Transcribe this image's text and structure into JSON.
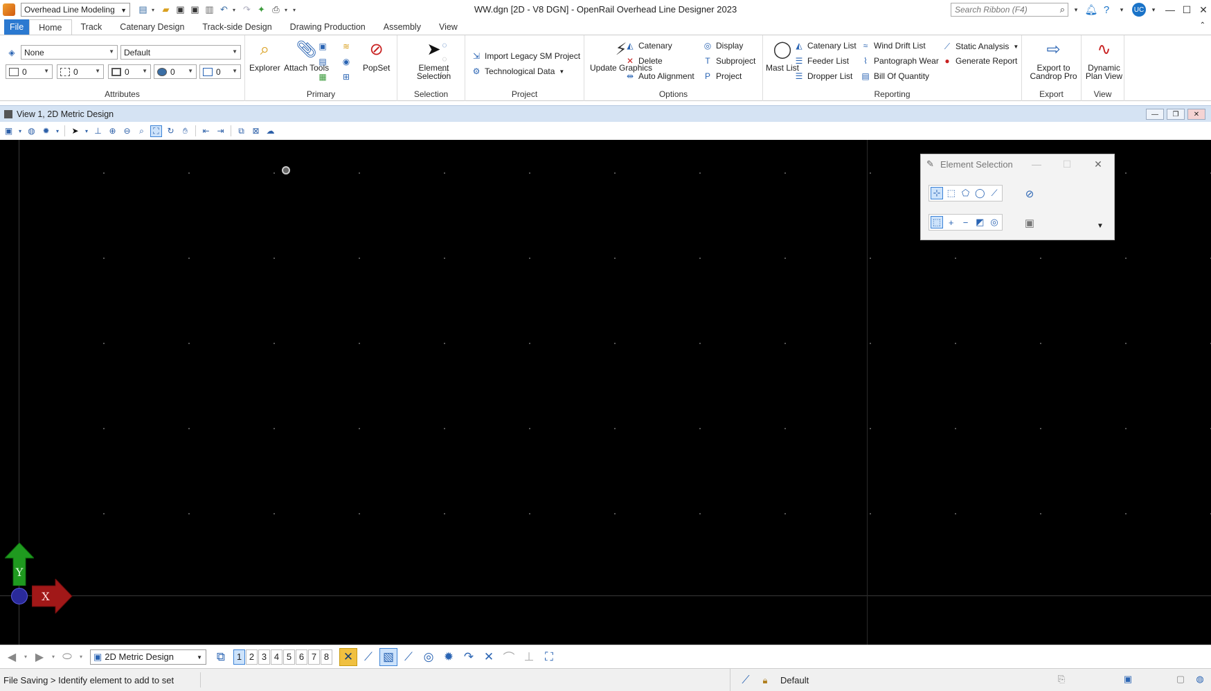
{
  "titlebar": {
    "workspace": "Overhead Line Modeling",
    "title": "WW.dgn [2D - V8 DGN] - OpenRail Overhead Line Designer 2023",
    "search_placeholder": "Search Ribbon (F4)",
    "user_initials": "UC"
  },
  "tabs": [
    "File",
    "Home",
    "Track",
    "Catenary Design",
    "Track-side Design",
    "Drawing Production",
    "Assembly",
    "View"
  ],
  "active_tab": "Home",
  "ribbon": {
    "attributes": {
      "label": "Attributes",
      "level": "None",
      "style": "Default",
      "color": "0",
      "weight": "0",
      "line_style": "0",
      "transparency": "0",
      "priority": "0"
    },
    "primary": {
      "label": "Primary",
      "explorer": "Explorer",
      "attach_tools": "Attach Tools",
      "popset": "PopSet"
    },
    "selection": {
      "label": "Selection",
      "element_selection": "Element Selection"
    },
    "project": {
      "label": "Project",
      "import_legacy": "Import Legacy SM Project",
      "technological_data": "Technological Data"
    },
    "options": {
      "label": "Options",
      "update_graphics": "Update Graphics",
      "catenary": "Catenary",
      "delete": "Delete",
      "auto_alignment": "Auto Alignment",
      "display": "Display",
      "subproject": "Subproject",
      "project": "Project"
    },
    "reporting": {
      "label": "Reporting",
      "mast_list": "Mast List",
      "catenary_list": "Catenary List",
      "feeder_list": "Feeder List",
      "dropper_list": "Dropper List",
      "wind_drift_list": "Wind Drift List",
      "pantograph_wear": "Pantograph Wear",
      "bill_of_quantity": "Bill Of Quantity",
      "static_analysis": "Static Analysis",
      "generate_report": "Generate Report"
    },
    "export": {
      "label": "Export",
      "export_candrop": "Export to Candrop Pro"
    },
    "view": {
      "label": "View",
      "dynamic_plan_view": "Dynamic Plan View"
    }
  },
  "view_window": {
    "title": "View 1, 2D Metric Design"
  },
  "element_selection": {
    "title": "Element Selection"
  },
  "axis": {
    "y_label": "Y",
    "x_label": "X"
  },
  "bottom_bar": {
    "model": "2D Metric Design",
    "view_numbers": [
      "1",
      "2",
      "3",
      "4",
      "5",
      "6",
      "7",
      "8"
    ],
    "active_view": "1"
  },
  "status": {
    "message": "File Saving > Identify element to add to set",
    "active_level": "Default"
  }
}
